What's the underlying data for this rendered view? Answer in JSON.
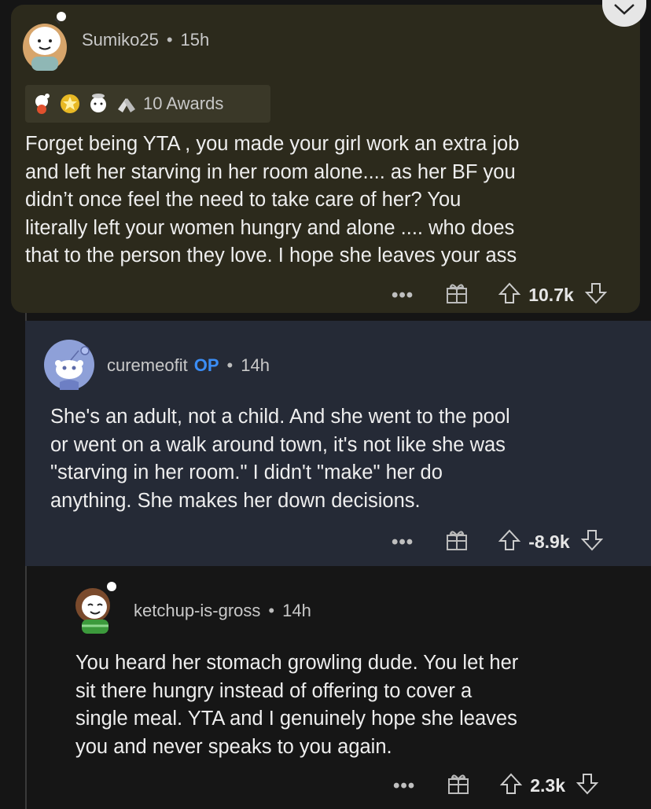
{
  "comments": [
    {
      "username": "Sumiko25",
      "separator": "•",
      "time": "15h",
      "awards_label": "10 Awards",
      "body_lines": [
        "Forget being YTA , you made your girl work an extra job",
        "and left her starving in her room alone.... as her BF you",
        "didn’t once feel the need to take care of her?  You",
        "literally left your women hungry and alone .... who does",
        "that to the person they love. I hope she leaves your ass"
      ],
      "more": "•••",
      "votes": "10.7k"
    },
    {
      "username": "curemeofit",
      "op_label": "OP",
      "separator": "•",
      "time": "14h",
      "body_lines": [
        "She's an adult, not a child. And she went to the pool",
        "or went on a walk around town, it's not like she was",
        "\"starving in her room.\" I didn't \"make\" her do",
        "anything. She makes her down decisions."
      ],
      "more": "•••",
      "votes": "-8.9k"
    },
    {
      "username": "ketchup-is-gross",
      "separator": "•",
      "time": "14h",
      "body_lines": [
        "You heard her stomach growling dude. You let her",
        "sit there hungry instead of offering to cover a",
        "single meal. YTA and I genuinely hope she leaves",
        "you and never speaks to you again."
      ],
      "more": "•••",
      "votes": "2.3k"
    }
  ],
  "colors": {
    "comment1_bg": "#2c2a1c",
    "comment2_bg": "#252a36",
    "op_blue": "#3b8df5"
  }
}
